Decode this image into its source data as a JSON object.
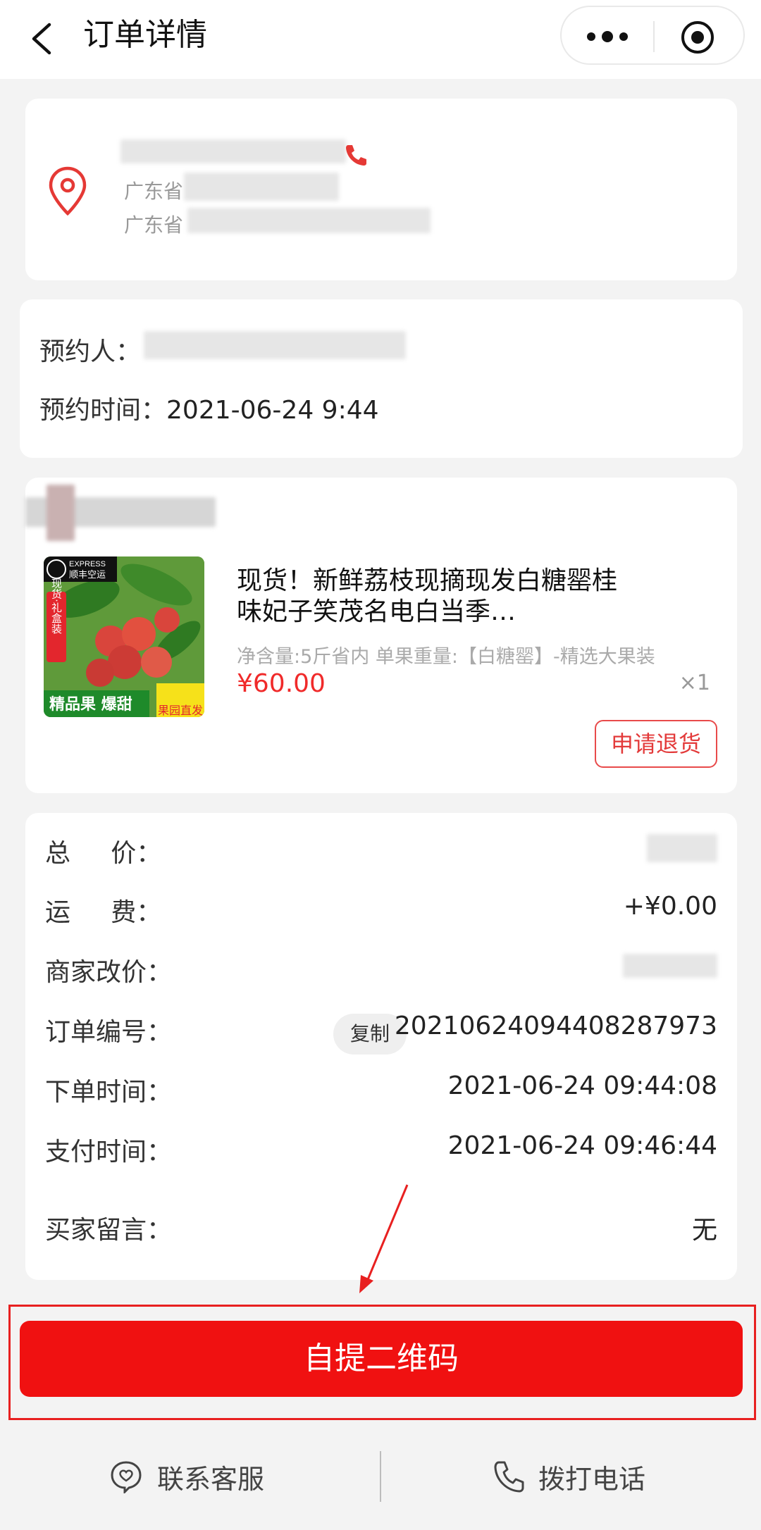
{
  "header": {
    "title": "订单详情"
  },
  "address": {
    "line1_prefix": "广东省",
    "line2_prefix": "广东省"
  },
  "booking": {
    "booker_label": "预约人：",
    "time_label": "预约时间：",
    "time_value": "2021-06-24 9:44"
  },
  "goods": {
    "title": "现货！新鲜荔枝现摘现发白糖罂桂味妃子笑茂名电白当季…",
    "spec": "净含量:5斤省内 单果重量:【白糖罂】-精选大果装",
    "price": "¥60.00",
    "quantity": "×1",
    "refund_label": "申请退货",
    "image_text": {
      "express_top": "EXPRESS",
      "express_bottom": "顺丰空运",
      "side_tag": "现货·礼盒装",
      "bottom_left": "精品果 爆甜",
      "bottom_right": "果园直发"
    }
  },
  "order_info": {
    "total_label": "总     价：",
    "shipping_label": "运     费：",
    "shipping_value": "+¥0.00",
    "adjust_label": "商家改价：",
    "order_no_label": "订单编号：",
    "copy_label": "复制",
    "order_no_value": "2021062409440828797 3",
    "order_time_label": "下单时间：",
    "order_time_value": "2021-06-24 09:44:08",
    "pay_time_label": "支付时间：",
    "pay_time_value": "2021-06-24 09:46:44",
    "message_label": "买家留言：",
    "message_value": "无"
  },
  "actions": {
    "qr_label": "自提二维码",
    "service_label": "联系客服",
    "call_label": "拨打电话"
  },
  "colors": {
    "accent": "#f01111",
    "price": "#f02a2a",
    "icon_red": "#e53935"
  }
}
